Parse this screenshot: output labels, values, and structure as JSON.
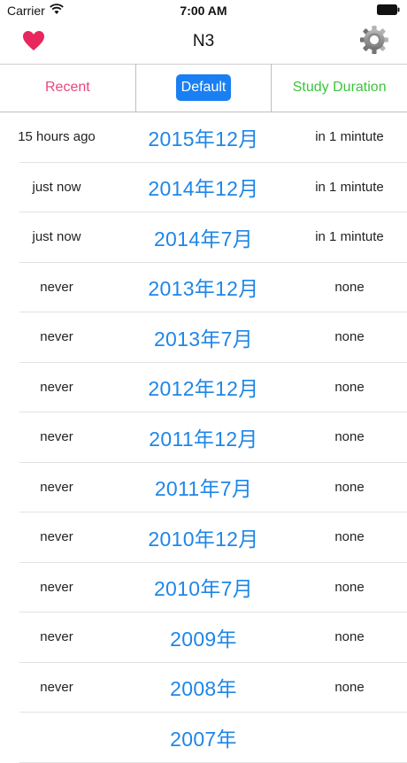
{
  "status_bar": {
    "carrier": "Carrier",
    "time": "7:00 AM"
  },
  "nav": {
    "title": "N3",
    "left_icon": "heart-icon",
    "right_icon": "gear-icon",
    "heart_color": "#e8275f"
  },
  "sort_bar": {
    "recent_label": "Recent",
    "default_label": "Default",
    "duration_label": "Study Duration",
    "selected": "Default"
  },
  "rows": [
    {
      "last": "15 hours ago",
      "title": "2015年12月",
      "duration": "in 1 mintute"
    },
    {
      "last": "just now",
      "title": "2014年12月",
      "duration": "in 1 mintute"
    },
    {
      "last": "just now",
      "title": "2014年7月",
      "duration": "in 1 mintute"
    },
    {
      "last": "never",
      "title": "2013年12月",
      "duration": "none"
    },
    {
      "last": "never",
      "title": "2013年7月",
      "duration": "none"
    },
    {
      "last": "never",
      "title": "2012年12月",
      "duration": "none"
    },
    {
      "last": "never",
      "title": "2011年12月",
      "duration": "none"
    },
    {
      "last": "never",
      "title": "2011年7月",
      "duration": "none"
    },
    {
      "last": "never",
      "title": "2010年12月",
      "duration": "none"
    },
    {
      "last": "never",
      "title": "2010年7月",
      "duration": "none"
    },
    {
      "last": "never",
      "title": "2009年",
      "duration": "none"
    },
    {
      "last": "never",
      "title": "2008年",
      "duration": "none"
    },
    {
      "last": "",
      "title": "2007年",
      "duration": ""
    }
  ]
}
